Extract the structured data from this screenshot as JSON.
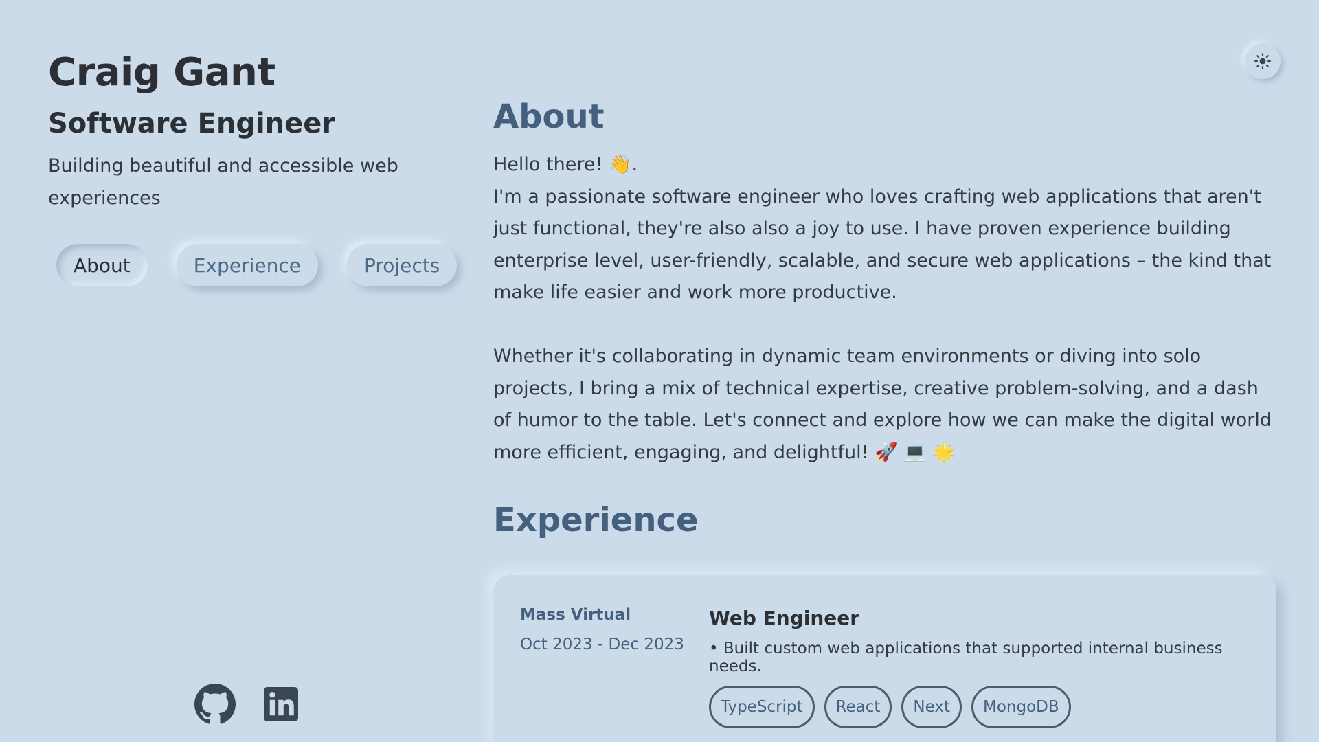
{
  "profile": {
    "name": "Craig Gant",
    "role": "Software Engineer",
    "tagline": "Building beautiful and accessible web experiences"
  },
  "nav": {
    "items": [
      {
        "label": "About",
        "active": true
      },
      {
        "label": "Experience",
        "active": false
      },
      {
        "label": "Projects",
        "active": false
      }
    ]
  },
  "socials": [
    {
      "icon": "github-icon"
    },
    {
      "icon": "linkedin-icon"
    }
  ],
  "theme_toggle": {
    "icon": "sun-icon"
  },
  "about": {
    "title": "About",
    "greeting": "Hello there! 👋.",
    "paragraph1": "I'm a passionate software engineer who loves crafting web applications that aren't just functional, they're also also a joy to use. I have proven experience building enterprise level, user-friendly, scalable, and secure web applications – the kind that make life easier and work more productive.",
    "paragraph2": "Whether it's collaborating in dynamic team environments or diving into solo projects, I bring a mix of technical expertise, creative problem-solving, and a dash of humor to the table. Let's connect and explore how we can make the digital world more efficient, engaging, and delightful! 🚀 💻 🌟"
  },
  "experience": {
    "title": "Experience",
    "jobs": [
      {
        "company": "Mass Virtual",
        "dates": "Oct 2023 - Dec 2023",
        "title": "Web Engineer",
        "bullet": "• Built custom web applications that supported internal business needs.",
        "tags": [
          "TypeScript",
          "React",
          "Next",
          "MongoDB"
        ]
      }
    ]
  },
  "colors": {
    "background": "#cbdbea",
    "accent": "#44607e",
    "text": "#2c3035"
  }
}
